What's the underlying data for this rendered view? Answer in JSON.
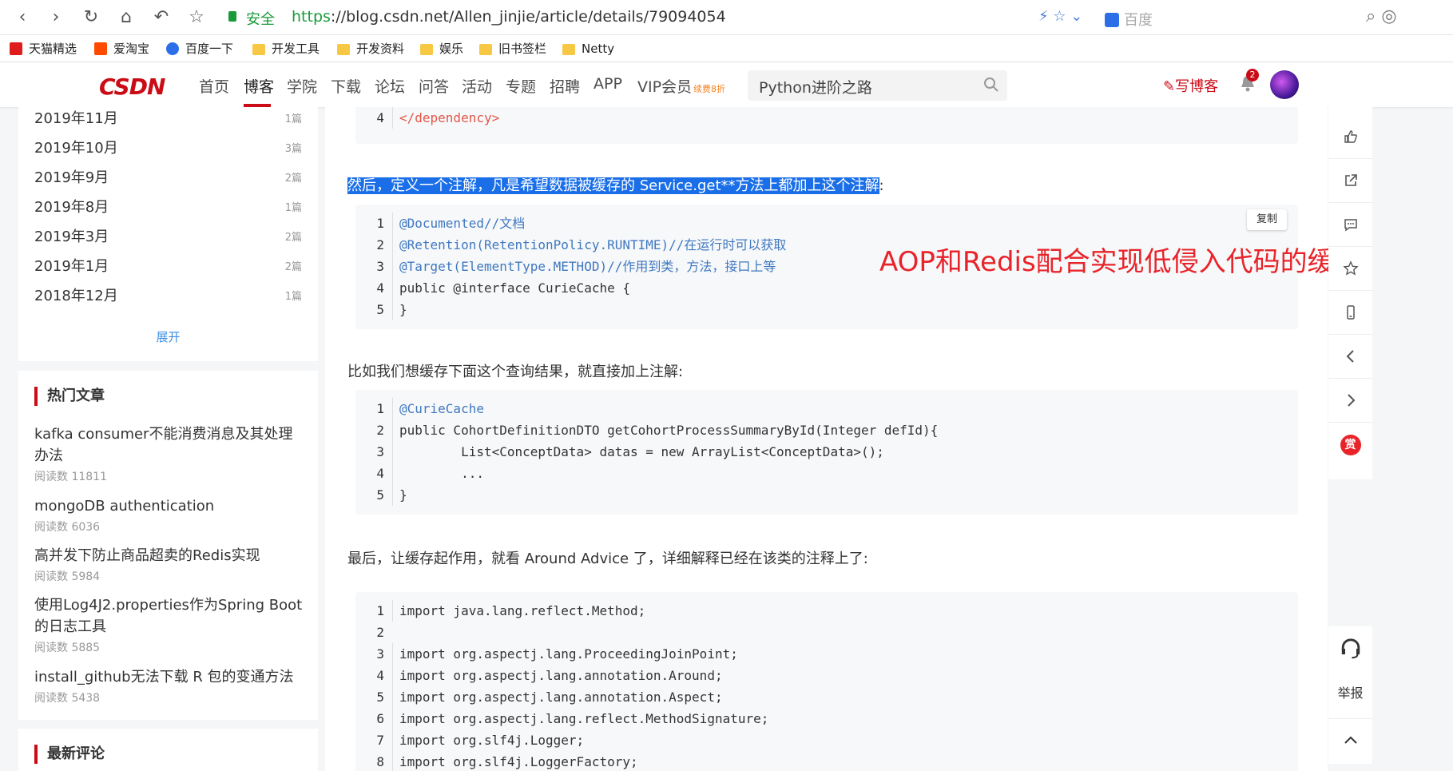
{
  "browser": {
    "secure_label": "安全",
    "url_scheme": "https",
    "url_rest": "://blog.csdn.net/Allen_jinjie/article/details/79094054",
    "search_engine": "百度"
  },
  "bookmarks": [
    {
      "label": "天猫精选",
      "icon": "tmall-icon"
    },
    {
      "label": "爱淘宝",
      "icon": "taobao-icon"
    },
    {
      "label": "百度一下",
      "icon": "baidu-icon"
    },
    {
      "label": "开发工具",
      "icon": "folder-icon"
    },
    {
      "label": "开发资料",
      "icon": "folder-icon"
    },
    {
      "label": "娱乐",
      "icon": "folder-icon"
    },
    {
      "label": "旧书签栏",
      "icon": "folder-icon"
    },
    {
      "label": "Netty",
      "icon": "folder-icon"
    }
  ],
  "header": {
    "logo": "CSDN",
    "nav": [
      "首页",
      "博客",
      "学院",
      "下载",
      "论坛",
      "问答",
      "活动",
      "专题",
      "招聘",
      "APP",
      "VIP会员"
    ],
    "vip_tag": "续费8折",
    "search_text": "Python进阶之路",
    "write_blog": "写博客",
    "notification_count": "2"
  },
  "archive": {
    "items": [
      {
        "month": "2019年11月",
        "count": "1篇"
      },
      {
        "month": "2019年10月",
        "count": "3篇"
      },
      {
        "month": "2019年9月",
        "count": "2篇"
      },
      {
        "month": "2019年8月",
        "count": "1篇"
      },
      {
        "month": "2019年3月",
        "count": "2篇"
      },
      {
        "month": "2019年1月",
        "count": "2篇"
      },
      {
        "month": "2018年12月",
        "count": "1篇"
      }
    ],
    "expand": "展开"
  },
  "hot": {
    "title": "热门文章",
    "items": [
      {
        "title": "kafka consumer不能消费消息及其处理办法",
        "reads": "阅读数 11811"
      },
      {
        "title": "mongoDB authentication",
        "reads": "阅读数 6036"
      },
      {
        "title": "高并发下防止商品超卖的Redis实现",
        "reads": "阅读数 5984"
      },
      {
        "title": "使用Log4J2.properties作为Spring Boot的日志工具",
        "reads": "阅读数 5885"
      },
      {
        "title": "install_github无法下载 R 包的变通方法",
        "reads": "阅读数 5438"
      }
    ]
  },
  "comments": {
    "title": "最新评论"
  },
  "article": {
    "code0_line": {
      "n": "4",
      "text": "</dependency>"
    },
    "para1": "然后，定义一个注解，凡是希望数据被缓存的 Service.get**方法上都加上这个注解",
    "para1_tail": ":",
    "copy": "复制",
    "code1": [
      {
        "n": "1",
        "text": "@Documented//文档"
      },
      {
        "n": "2",
        "text": "@Retention(RetentionPolicy.RUNTIME)//在运行时可以获取"
      },
      {
        "n": "3",
        "text": "@Target(ElementType.METHOD)//作用到类，方法，接口上等"
      },
      {
        "n": "4",
        "text": "public @interface CurieCache {"
      },
      {
        "n": "5",
        "text": "}"
      }
    ],
    "annotation": "AOP和Redis配合实现低侵入代码的缓存",
    "para2": "比如我们想缓存下面这个查询结果，就直接加上注解:",
    "code2": [
      {
        "n": "1",
        "text": "@CurieCache"
      },
      {
        "n": "2",
        "text": "public CohortDefinitionDTO getCohortProcessSummaryById(Integer defId){"
      },
      {
        "n": "3",
        "text": "        List<ConceptData> datas = new ArrayList<ConceptData>();"
      },
      {
        "n": "4",
        "text": "        ..."
      },
      {
        "n": "5",
        "text": "}"
      }
    ],
    "para3": "最后，让缓存起作用，就看 Around Advice 了，详细解释已经在该类的注释上了:",
    "code3": [
      {
        "n": "1",
        "text": "import java.lang.reflect.Method;"
      },
      {
        "n": "2",
        "text": ""
      },
      {
        "n": "3",
        "text": "import org.aspectj.lang.ProceedingJoinPoint;"
      },
      {
        "n": "4",
        "text": "import org.aspectj.lang.annotation.Around;"
      },
      {
        "n": "5",
        "text": "import org.aspectj.lang.annotation.Aspect;"
      },
      {
        "n": "6",
        "text": "import org.aspectj.lang.reflect.MethodSignature;"
      },
      {
        "n": "7",
        "text": "import org.slf4j.Logger;"
      },
      {
        "n": "8",
        "text": "import org.slf4j.LoggerFactory;"
      }
    ]
  },
  "toolbar": {
    "reward": "赏",
    "report": "举报"
  },
  "colors": {
    "brand": "#ca0c16",
    "highlight": "#1a6fe8",
    "annotation": "#e8242a"
  }
}
